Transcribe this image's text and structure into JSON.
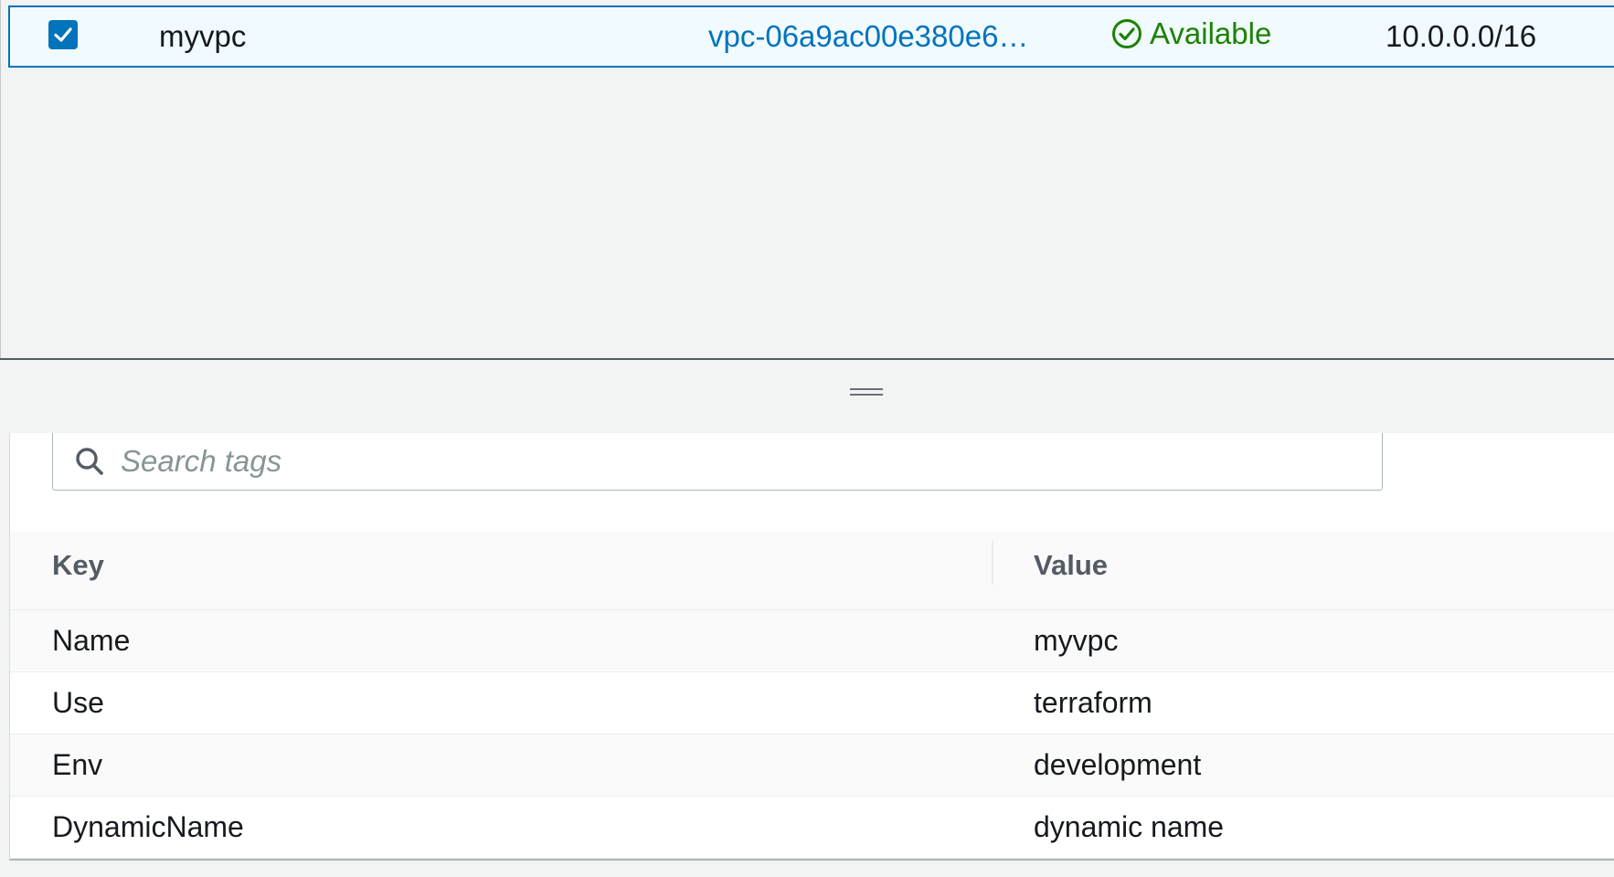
{
  "vpc_row": {
    "selected": true,
    "name": "myvpc",
    "vpc_id": "vpc-06a9ac00e380e6…",
    "state": "Available",
    "cidr": "10.0.0.0/16"
  },
  "tags_panel": {
    "search_placeholder": "Search tags",
    "columns": {
      "key": "Key",
      "value": "Value"
    },
    "rows": [
      {
        "key": "Name",
        "value": "myvpc"
      },
      {
        "key": "Use",
        "value": "terraform"
      },
      {
        "key": "Env",
        "value": "development"
      },
      {
        "key": "DynamicName",
        "value": "dynamic name"
      }
    ]
  },
  "colors": {
    "link": "#0073bb",
    "available_green": "#1d8102",
    "selected_row_bg": "#f1faff"
  },
  "icons": {
    "checkbox": "checkbox-checked-icon",
    "status": "check-circle-icon",
    "search": "search-icon",
    "resize": "drag-handle-icon"
  }
}
